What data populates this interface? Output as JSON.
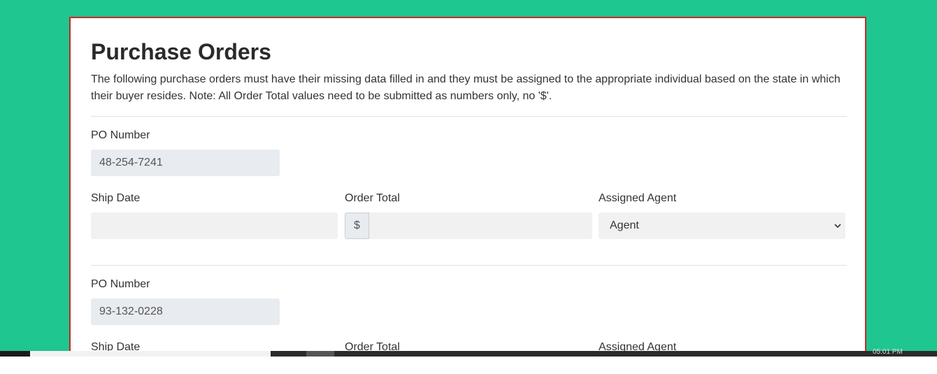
{
  "page": {
    "title": "Purchase Orders",
    "description": "The following purchase orders must have their missing data filled in and they must be assigned to the appropriate individual based on the state in which their buyer resides. Note: All Order Total values need to be submitted as numbers only, no '$'."
  },
  "orders": [
    {
      "po_label": "PO Number",
      "po_value": "48-254-7241",
      "ship_date_label": "Ship Date",
      "ship_date_value": "",
      "order_total_label": "Order Total",
      "currency_symbol": "$",
      "order_total_value": "",
      "agent_label": "Assigned Agent",
      "agent_selected": "Agent"
    },
    {
      "po_label": "PO Number",
      "po_value": "93-132-0228",
      "ship_date_label": "Ship Date",
      "order_total_label": "Order Total",
      "agent_label": "Assigned Agent"
    }
  ],
  "taskbar": {
    "clock": "05:01 PM"
  },
  "colors": {
    "background": "#1fc68f",
    "card_border": "#c62828",
    "readonly_field": "#e8ebef",
    "input_field": "#f1f1f1"
  }
}
